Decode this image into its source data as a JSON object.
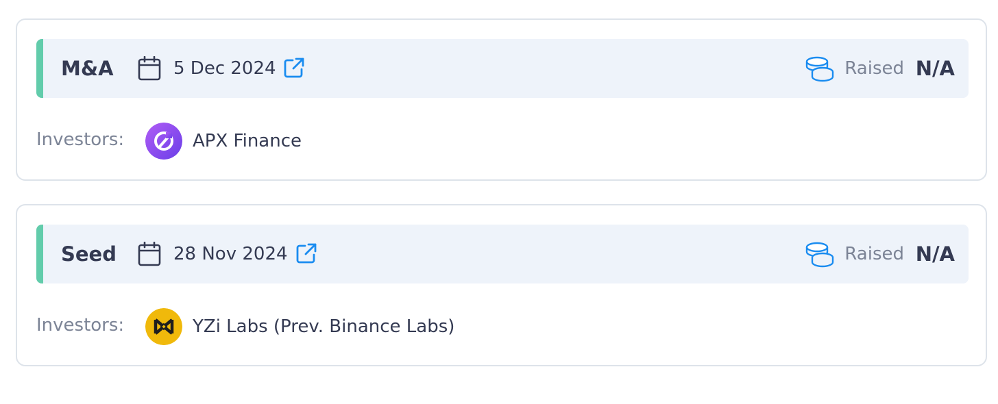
{
  "rounds": [
    {
      "type": "M&A",
      "date": "5 Dec 2024",
      "raised_label": "Raised",
      "raised_value": "N/A",
      "investors_label": "Investors:",
      "investor": {
        "name": "APX Finance",
        "avatar_icon": "apx-finance-logo"
      }
    },
    {
      "type": "Seed",
      "date": "28 Nov 2024",
      "raised_label": "Raised",
      "raised_value": "N/A",
      "investors_label": "Investors:",
      "investor": {
        "name": "YZi Labs (Prev. Binance Labs)",
        "avatar_icon": "yzi-labs-logo"
      }
    }
  ],
  "colors": {
    "accent": "#62ccab",
    "link_blue": "#1a8cf0",
    "header_bg": "#eef3fa",
    "apx_purple": "#8b4ff0",
    "yzi_yellow": "#f0b90b"
  }
}
